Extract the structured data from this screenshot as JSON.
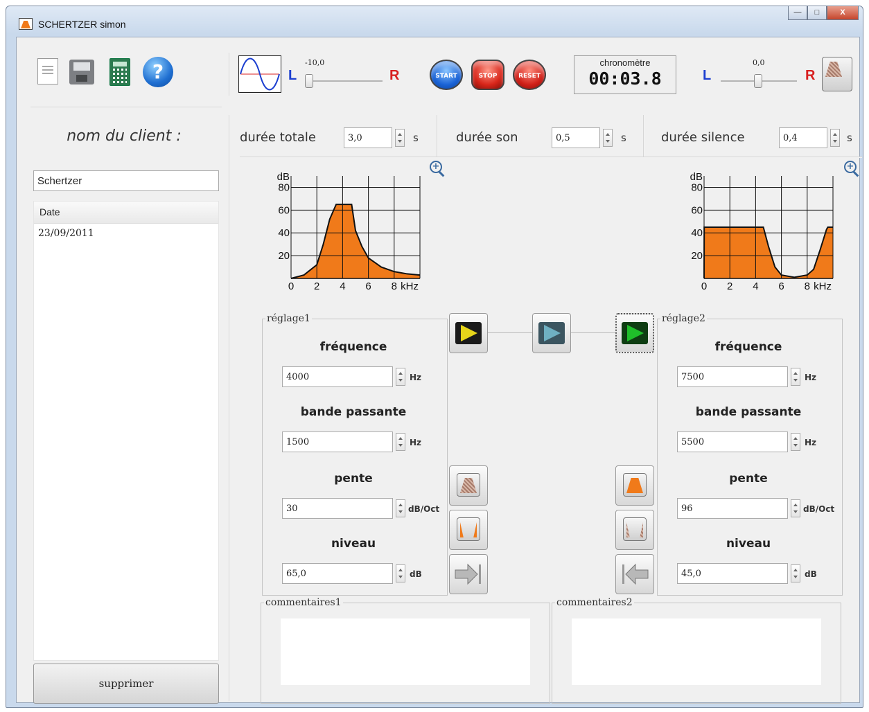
{
  "window": {
    "title": "SCHERTZER simon",
    "controls": [
      "minimize",
      "maximize",
      "close"
    ]
  },
  "toolbar": {
    "icons": [
      "new-document-icon",
      "save-icon",
      "calculator-icon",
      "help-icon"
    ],
    "help_glyph": "?",
    "left_slider": {
      "L": "L",
      "R": "R",
      "value_label": "-10,0",
      "value": -10.0
    },
    "right_slider": {
      "L": "L",
      "R": "R",
      "value_label": "0,0",
      "value": 0.0
    },
    "start_label": "START",
    "stop_label": "STOP",
    "reset_label": "RESET",
    "chrono_label": "chronomètre",
    "chrono_time": "00:03.8"
  },
  "left_panel": {
    "label": "nom du client :",
    "client_name": "Schertzer",
    "list_header": "Date",
    "rows": [
      "23/09/2011"
    ],
    "delete_label": "supprimer"
  },
  "durations": {
    "total_label": "durée totale",
    "total_value": "3,0",
    "total_unit": "s",
    "sound_label": "durée son",
    "sound_value": "0,5",
    "sound_unit": "s",
    "silence_label": "durée silence",
    "silence_value": "0,4",
    "silence_unit": "s"
  },
  "chart_data": [
    {
      "type": "area",
      "ylabel": "dB",
      "xlabel": "kHz",
      "x_ticks": [
        "0",
        "2",
        "4",
        "6",
        "8"
      ],
      "y_ticks": [
        "20",
        "40",
        "60",
        "80"
      ],
      "xlim": [
        0,
        10
      ],
      "ylim": [
        0,
        90
      ],
      "x": [
        0,
        1,
        2,
        2.5,
        3,
        3.5,
        4,
        4.7,
        5,
        5.5,
        6,
        7,
        8,
        9,
        10
      ],
      "y": [
        0,
        3,
        12,
        30,
        52,
        65,
        65,
        65,
        42,
        28,
        18,
        10,
        6,
        4,
        3
      ]
    },
    {
      "type": "area",
      "ylabel": "dB",
      "xlabel": "kHz",
      "x_ticks": [
        "0",
        "2",
        "4",
        "6",
        "8"
      ],
      "y_ticks": [
        "20",
        "40",
        "60",
        "80"
      ],
      "xlim": [
        0,
        10
      ],
      "ylim": [
        0,
        90
      ],
      "x": [
        0,
        0.01,
        4.6,
        5,
        5.5,
        6,
        7,
        8,
        8.5,
        9,
        9.5,
        9.6,
        10
      ],
      "y": [
        0,
        45,
        45,
        28,
        10,
        3,
        1,
        3,
        8,
        25,
        43,
        45,
        45
      ]
    }
  ],
  "reglage1": {
    "title": "réglage1",
    "freq_label": "fréquence",
    "freq_value": "4000",
    "freq_unit": "Hz",
    "bw_label": "bande passante",
    "bw_value": "1500",
    "bw_unit": "Hz",
    "slope_label": "pente",
    "slope_value": "30",
    "slope_unit": "dB/Oct",
    "level_label": "niveau",
    "level_value": "65,0",
    "level_unit": "dB"
  },
  "reglage2": {
    "title": "réglage2",
    "freq_label": "fréquence",
    "freq_value": "7500",
    "freq_unit": "Hz",
    "bw_label": "bande passante",
    "bw_value": "5500",
    "bw_unit": "Hz",
    "slope_label": "pente",
    "slope_value": "96",
    "slope_unit": "dB/Oct",
    "level_label": "niveau",
    "level_value": "45,0",
    "level_unit": "dB"
  },
  "comments": {
    "c1_title": "commentaires1",
    "c2_title": "commentaires2",
    "c1_value": "",
    "c2_value": ""
  },
  "colors": {
    "accent_orange": "#f07a1a",
    "left_channel": "#1c3fd0",
    "right_channel": "#d82020",
    "play_yellow": "#e6d51a",
    "play_green": "#1fbf2a"
  }
}
